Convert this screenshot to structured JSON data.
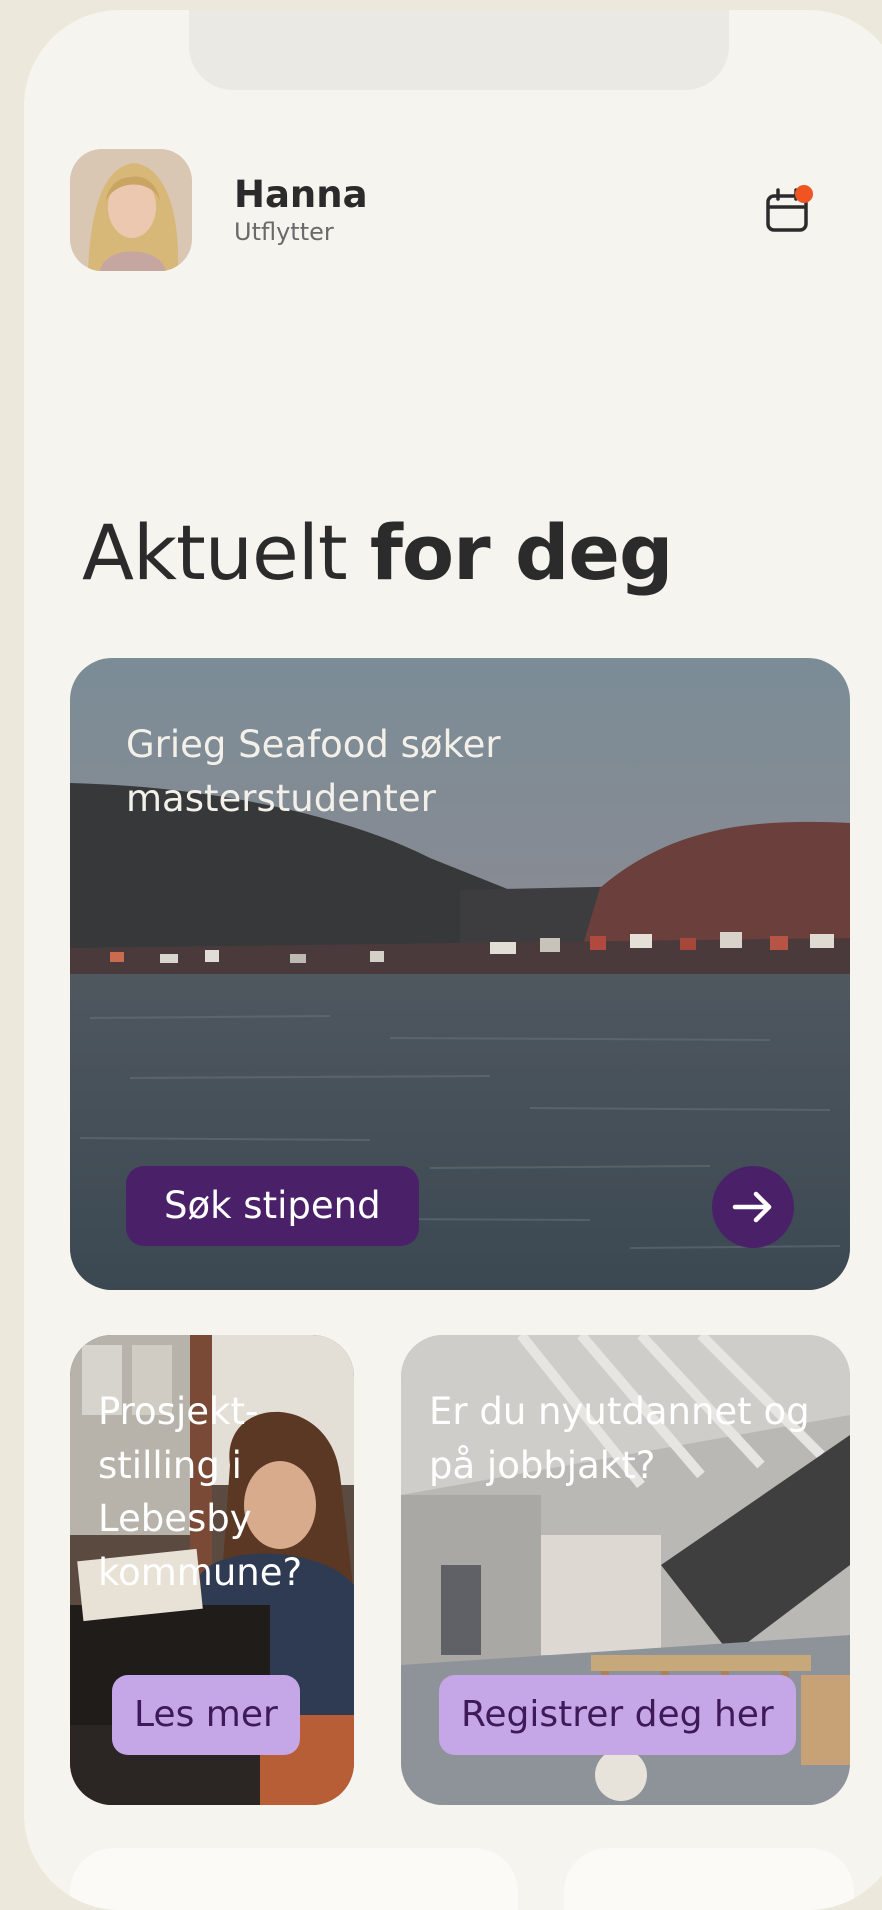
{
  "header": {
    "name": "Hanna",
    "role": "Utflytter"
  },
  "page": {
    "title_regular": "Aktuelt",
    "title_bold": "for deg"
  },
  "hero": {
    "title": "Grieg Seafood søker masterstudenter",
    "button_label": "Søk stipend"
  },
  "cards": [
    {
      "title": "Prosjekt-stilling i Lebesby kommune?",
      "button_label": "Les mer"
    },
    {
      "title": "Er du nyutdannet og på jobbjakt?",
      "button_label": "Registrer deg her"
    }
  ],
  "colors": {
    "primary_purple": "#4a2168",
    "lilac": "#c5a6e6",
    "notification_dot": "#ef5422",
    "background": "#f6f4ef"
  }
}
